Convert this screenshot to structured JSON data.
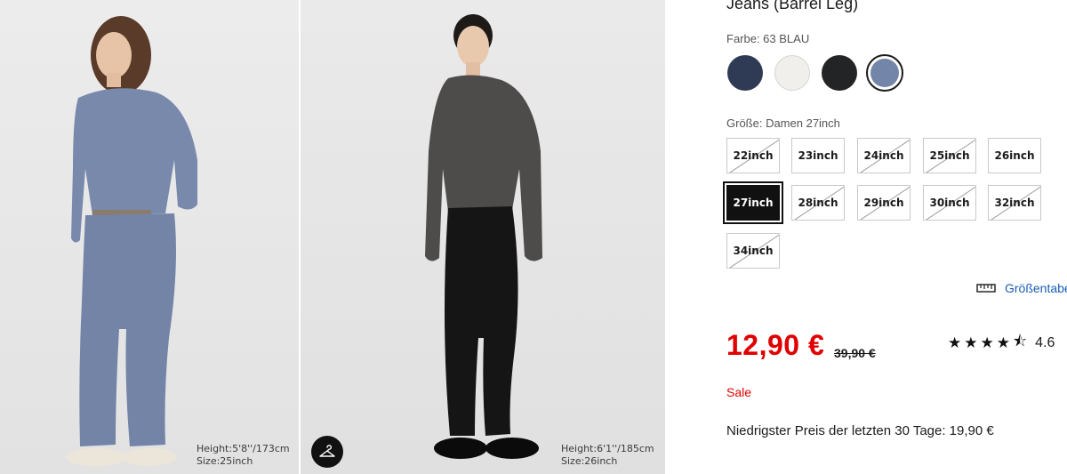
{
  "photos": [
    {
      "caption_height": "Height:5'8''/173cm",
      "caption_size": "Size:25inch"
    },
    {
      "caption_height": "Height:6'1''/185cm",
      "caption_size": "Size:26inch"
    }
  ],
  "product": {
    "title": "Jeans (Barrel Leg)"
  },
  "color": {
    "label": "Farbe: 63 BLAU",
    "swatches": [
      {
        "name": "navy",
        "hex": "#2f3a55"
      },
      {
        "name": "off-white",
        "hex": "#f0efeb"
      },
      {
        "name": "black",
        "hex": "#232426"
      },
      {
        "name": "blue",
        "hex": "#7385a8",
        "selected": true
      }
    ]
  },
  "size": {
    "label": "Größe: Damen 27inch",
    "options": [
      {
        "label": "22inch",
        "available": false
      },
      {
        "label": "23inch",
        "available": true
      },
      {
        "label": "24inch",
        "available": false
      },
      {
        "label": "25inch",
        "available": false
      },
      {
        "label": "26inch",
        "available": true
      },
      {
        "label": "27inch",
        "available": true,
        "selected": true
      },
      {
        "label": "28inch",
        "available": false
      },
      {
        "label": "29inch",
        "available": false
      },
      {
        "label": "30inch",
        "available": false
      },
      {
        "label": "32inch",
        "available": false
      },
      {
        "label": "34inch",
        "available": false
      }
    ],
    "chart_link": "Größentabelle"
  },
  "pricing": {
    "price": "12,90 €",
    "old_price": "39,90 €",
    "sale_label": "Sale",
    "lowest_price_note": "Niedrigster Preis der letzten 30 Tage: 19,90 €"
  },
  "rating": {
    "value": "4.6",
    "stars": 4.5
  },
  "colors": {
    "price_red": "#e00000",
    "link_blue": "#1a5fb4"
  }
}
